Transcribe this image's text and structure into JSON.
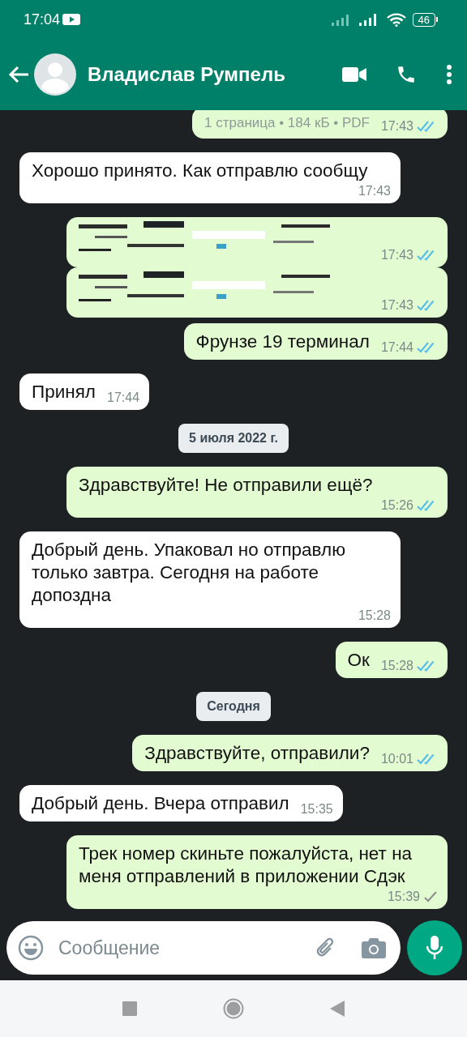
{
  "status_bar": {
    "time": "17:04",
    "battery": "46"
  },
  "header": {
    "contact_name": "Владислав Румпель"
  },
  "messages": [
    {
      "kind": "file-meta",
      "outgoing": true,
      "text": "1 страница • 184 кБ • PDF",
      "time": "17:43",
      "read": true
    },
    {
      "kind": "text",
      "outgoing": false,
      "text": "Хорошо принято. Как отправлю сообщу",
      "time": "17:43"
    },
    {
      "kind": "garbled",
      "outgoing": true,
      "time": "17:43",
      "read": true
    },
    {
      "kind": "garbled",
      "outgoing": true,
      "time": "17:43",
      "read": true
    },
    {
      "kind": "text",
      "outgoing": true,
      "text": "Фрунзе 19 терминал",
      "time": "17:44",
      "read": true
    },
    {
      "kind": "text",
      "outgoing": false,
      "text": "Принял",
      "time": "17:44"
    },
    {
      "kind": "date",
      "text": "5 июля 2022 г."
    },
    {
      "kind": "text",
      "outgoing": true,
      "text": "Здравствуйте! Не отправили ещё?",
      "time": "15:26",
      "read": true
    },
    {
      "kind": "text",
      "outgoing": false,
      "text": "Добрый день. Упаковал но отправлю только завтра. Сегодня на работе допоздна",
      "time": "15:28"
    },
    {
      "kind": "text",
      "outgoing": true,
      "text": "Ок",
      "time": "15:28",
      "read": true
    },
    {
      "kind": "date",
      "text": "Сегодня"
    },
    {
      "kind": "text",
      "outgoing": true,
      "text": "Здравствуйте, отправили?",
      "time": "10:01",
      "read": true
    },
    {
      "kind": "text",
      "outgoing": false,
      "text": "Добрый день. Вчера отправил",
      "time": "15:35"
    },
    {
      "kind": "text",
      "outgoing": true,
      "text": "Трек номер скиньте пожалуйста, нет на меня отправлений в приложении Сдэк",
      "time": "15:39",
      "read": false
    }
  ],
  "composer": {
    "placeholder": "Сообщение"
  }
}
